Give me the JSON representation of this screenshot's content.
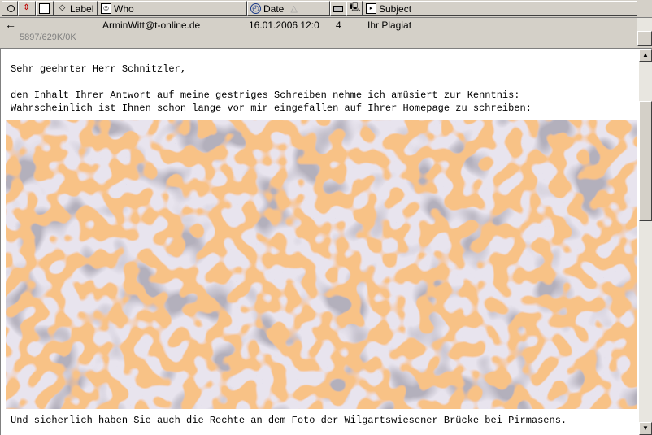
{
  "header": {
    "columns": [
      {
        "icon": "status-icon"
      },
      {
        "icon": "priority-icon"
      },
      {
        "icon": "attachment-icon"
      },
      {
        "icon": "label-icon",
        "label": "Label"
      },
      {
        "icon": "person-icon",
        "label": "Who"
      },
      {
        "icon": "clock-icon",
        "label": "Date",
        "sort": "ascending"
      },
      {
        "icon": "size-icon"
      },
      {
        "icon": "server-icon"
      },
      {
        "icon": "subject-icon",
        "label": "Subject"
      }
    ]
  },
  "message": {
    "who": "ArminWitt@t-online.de",
    "date": "16.01.2006  12:0",
    "size": "4",
    "subject": "Ihr Plagiat",
    "status_text": "5897/629K/0K"
  },
  "body": {
    "greeting": "Sehr geehrter Herr Schnitzler,",
    "line1": "den Inhalt Ihrer Antwort auf meine gestriges Schreiben nehme ich amüsiert zur Kenntnis:",
    "line2": "Wahrscheinlich ist Ihnen schon lange vor mir eingefallen auf Ihrer Homepage zu schreiben:",
    "line3": "Und sicherlich haben Sie auch die Rechte an dem Foto der Wilgartswiesener Brücke bei Pirmasens."
  },
  "colors": {
    "chrome": "#d4d0c8",
    "image_base": "#e8e4ee",
    "image_edges": "#f08a3c"
  }
}
